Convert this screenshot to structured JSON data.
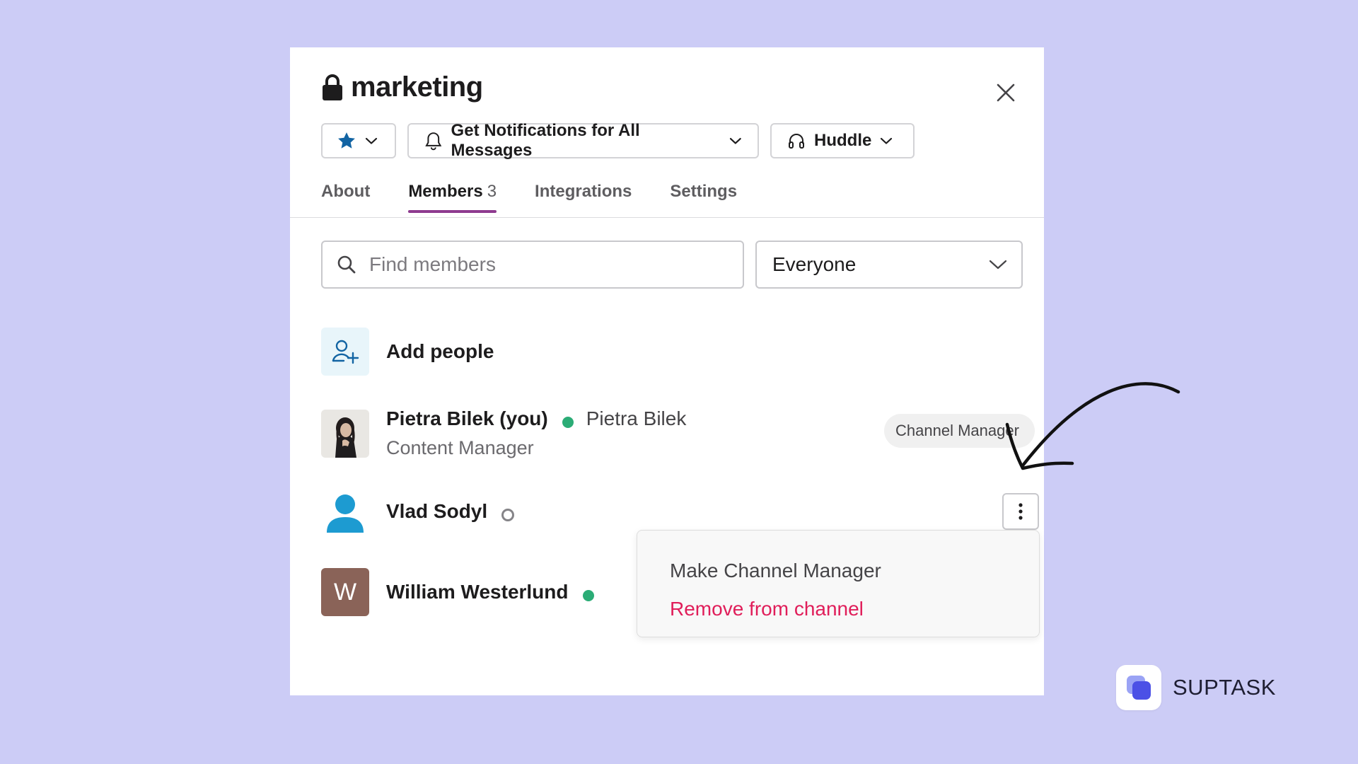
{
  "channel": {
    "name": "marketing"
  },
  "toolbar": {
    "notifications_label": "Get Notifications for All Messages",
    "huddle_label": "Huddle"
  },
  "tabs": [
    {
      "label": "About"
    },
    {
      "label": "Members",
      "count": "3",
      "active": true
    },
    {
      "label": "Integrations"
    },
    {
      "label": "Settings"
    }
  ],
  "search": {
    "placeholder": "Find members",
    "value": ""
  },
  "filter": {
    "selected": "Everyone"
  },
  "add_people": {
    "label": "Add people"
  },
  "members": [
    {
      "name": "Pietra Bilek (you)",
      "status": "online",
      "display_name": "Pietra Bilek",
      "title": "Content Manager",
      "role_badge": "Channel Manager"
    },
    {
      "name": "Vlad Sodyl",
      "status": "away"
    },
    {
      "name": "William Westerlund",
      "status": "online",
      "initial": "W"
    }
  ],
  "context_menu": {
    "items": [
      {
        "label": "Make Channel Manager",
        "style": "normal"
      },
      {
        "label": "Remove from channel",
        "style": "danger"
      }
    ]
  },
  "colors": {
    "background": "#ccccf6",
    "active_tab_underline": "#8e3b8f",
    "online": "#2bac76",
    "danger": "#e01e5a",
    "star": "#1264a3"
  },
  "brand": {
    "name": "SUPTASK"
  }
}
